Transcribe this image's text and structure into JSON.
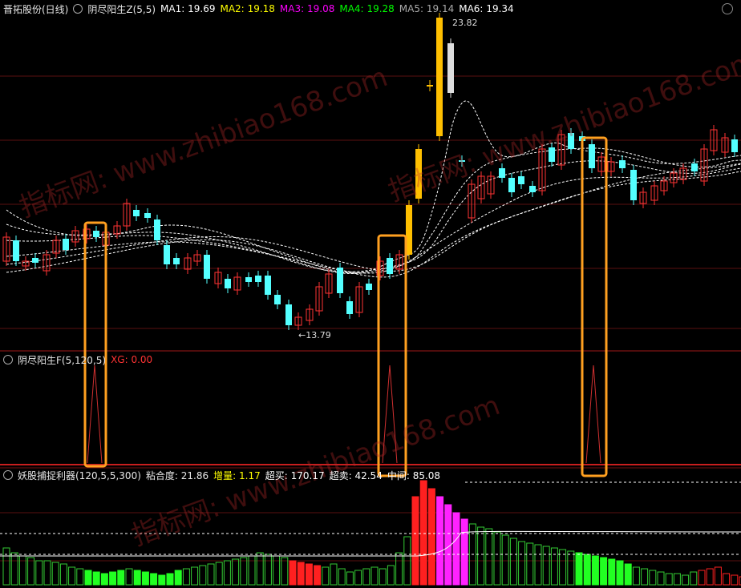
{
  "main": {
    "title": "晋拓股份(日线)",
    "indicator": "阴尽阳生Z(5,5)",
    "ma": [
      {
        "label": "MA1:",
        "value": "19.69"
      },
      {
        "label": "MA2:",
        "value": "19.18"
      },
      {
        "label": "MA3:",
        "value": "19.08"
      },
      {
        "label": "MA4:",
        "value": "19.28"
      },
      {
        "label": "MA5:",
        "value": "19.14"
      },
      {
        "label": "MA6:",
        "value": "19.34"
      }
    ],
    "high_label": "23.82",
    "low_label": "←13.79"
  },
  "sub1": {
    "title": "阴尽阳生F(5,120,5)",
    "xg_label": "XG:",
    "xg_value": "0.00"
  },
  "sub2": {
    "title": "妖股捕捉利器(120,5,5,300)",
    "items": [
      {
        "label": "粘合度:",
        "value": "21.86"
      },
      {
        "label": "增量:",
        "value": "1.17"
      },
      {
        "label": "超买:",
        "value": "170.17"
      },
      {
        "label": "超卖:",
        "value": "42.54"
      },
      {
        "label": "中间:",
        "value": "85.08"
      }
    ]
  },
  "watermark": [
    "指标网: www.zhibiao168.com",
    "指标网: www.zhibiao168.com",
    "指标网: www.zhibiao168.com"
  ],
  "colors": {
    "up": "#ff3333",
    "down": "#54ffff",
    "limit": "#ffbf00",
    "box": "#ffa020",
    "signal": "#d03030"
  }
}
